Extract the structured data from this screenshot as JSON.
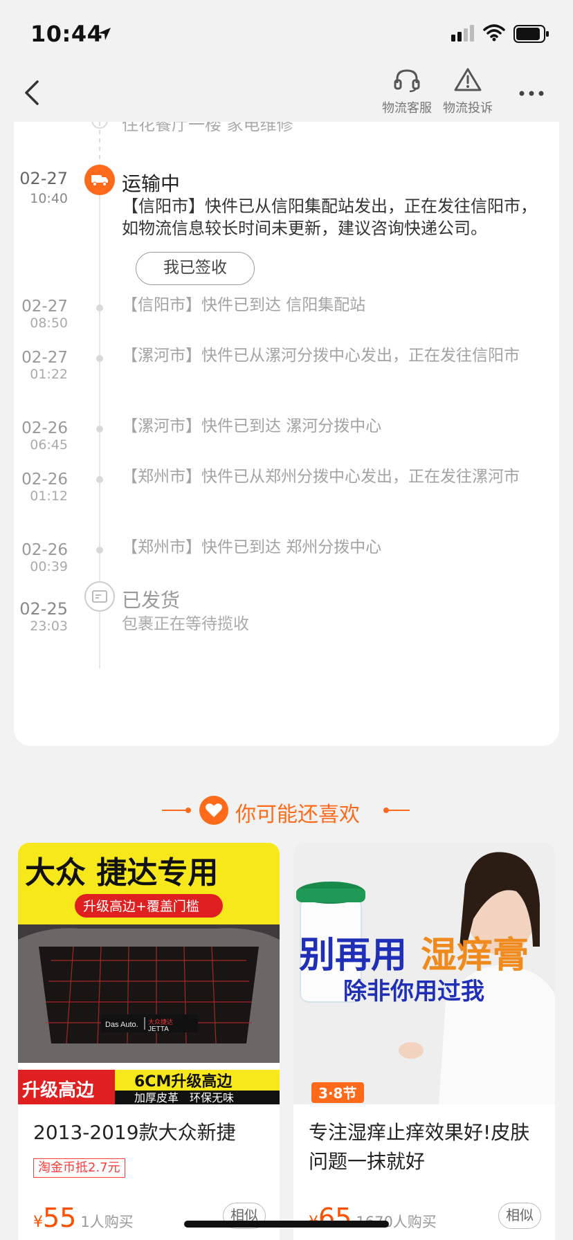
{
  "status_bar": {
    "time": "10:44"
  },
  "nav": {
    "actions": [
      {
        "label": "物流客服",
        "icon": "headset-icon"
      },
      {
        "label": "物流投诉",
        "icon": "warning-icon"
      }
    ]
  },
  "timeline": {
    "cut_text": "住花餐厅一楼 家电维修",
    "active": {
      "date": "02-27",
      "time": "10:40",
      "title": "运输中",
      "text": "【信阳市】快件已从信阳集配站发出，正在发往信阳市，如物流信息较长时间未更新，建议咨询快递公司。",
      "button": "我已签收"
    },
    "events": [
      {
        "date": "02-27",
        "time": "08:50",
        "text": "【信阳市】快件已到达 信阳集配站"
      },
      {
        "date": "02-27",
        "time": "01:22",
        "text": "【漯河市】快件已从漯河分拨中心发出，正在发往信阳市"
      },
      {
        "date": "02-26",
        "time": "06:45",
        "text": "【漯河市】快件已到达 漯河分拨中心"
      },
      {
        "date": "02-26",
        "time": "01:12",
        "text": "【郑州市】快件已从郑州分拨中心发出，正在发往漯河市"
      },
      {
        "date": "02-26",
        "time": "00:39",
        "text": "【郑州市】快件已到达 郑州分拨中心"
      }
    ],
    "shipped": {
      "date": "02-25",
      "time": "23:03",
      "title": "已发货",
      "sub": "包裹正在等待揽收"
    }
  },
  "recommend": {
    "title": "你可能还喜欢",
    "accent": "#ff6a1a",
    "products": [
      {
        "img_headline": "大众 捷达专用",
        "img_badge": "升级高边+覆盖门槛",
        "img_logo_left": "Das Auto.",
        "img_logo_right": "JETTA",
        "img_logo_top": "大众捷达",
        "img_bottom_left": "升级高边",
        "img_bottom_right_top": "6CM升级高边",
        "img_bottom_right_bottom": "加厚皮革　环保无味",
        "title": "2013-2019款大众新捷",
        "coin_tag": "淘金币抵2.7元",
        "price_symbol": "¥",
        "price": "55",
        "buyers": "1人购买",
        "similar": "相似"
      },
      {
        "img_headline_a": "别再用",
        "img_headline_b": "湿痒膏",
        "img_sub": "除非你用过我",
        "img_badge": "3·8节",
        "title": "专注湿痒止痒效果好!皮肤问题一抹就好",
        "price_symbol": "¥",
        "price": "65",
        "buyers": "1670人购买",
        "similar": "相似"
      }
    ]
  }
}
